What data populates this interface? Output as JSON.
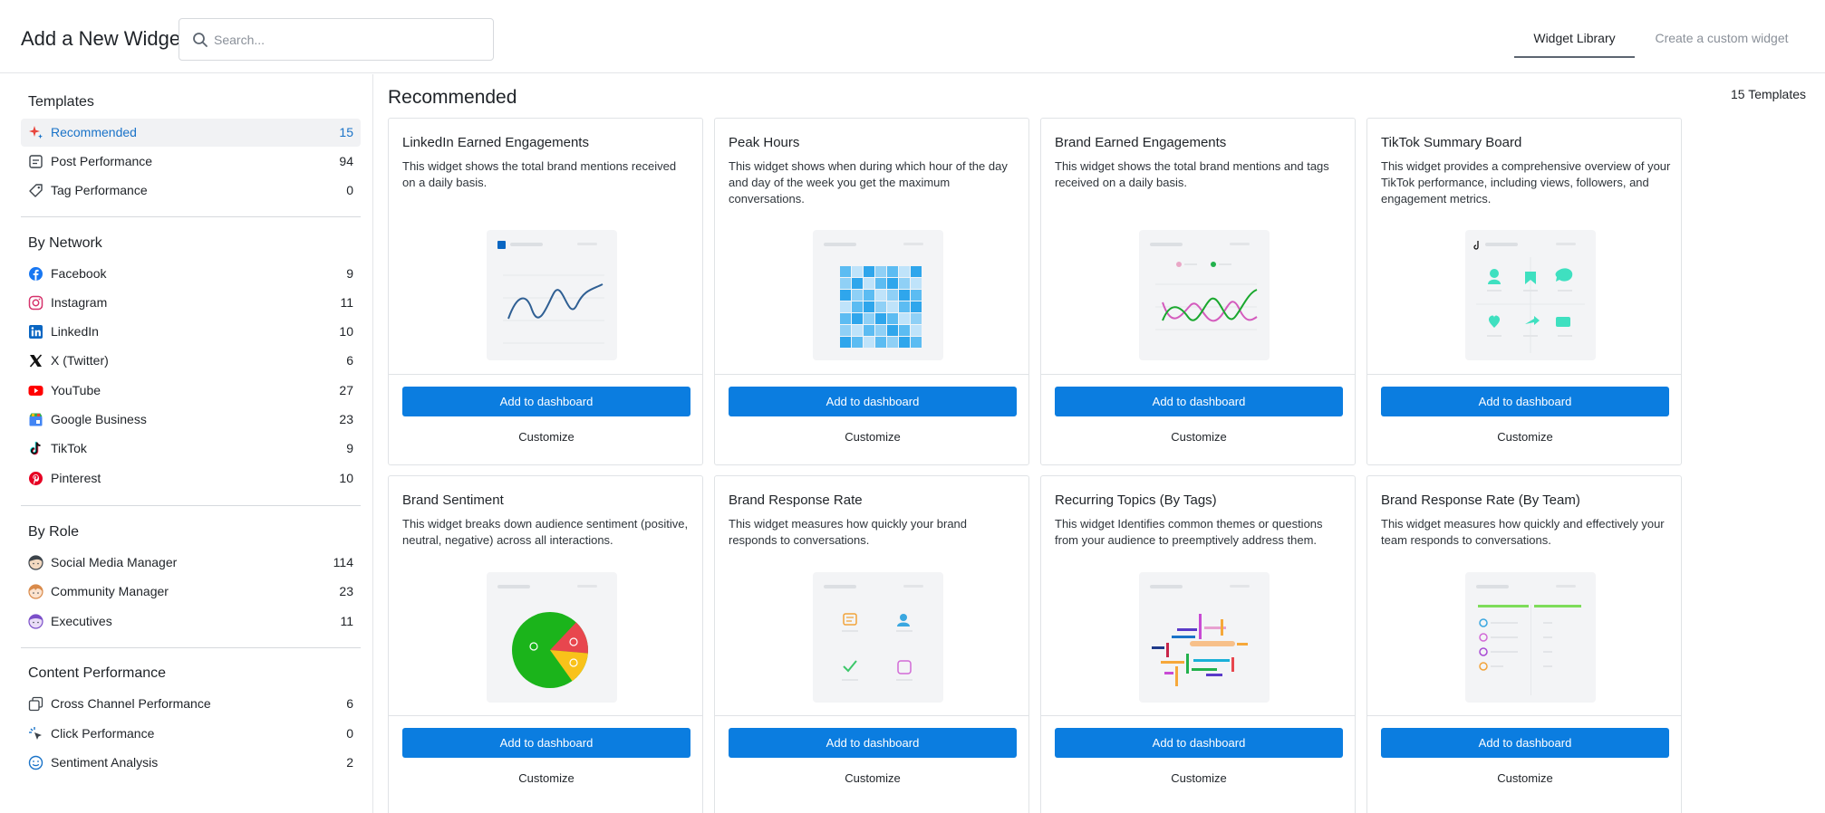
{
  "header": {
    "title": "Add a New Widget",
    "search_placeholder": "Search...",
    "tabs": [
      {
        "label": "Widget Library",
        "active": true
      },
      {
        "label": "Create a custom widget",
        "active": false
      }
    ]
  },
  "sidebar": {
    "sections": [
      {
        "title": "Templates",
        "items": [
          {
            "label": "Recommended",
            "count": "15",
            "icon": "sparkle-icon",
            "active": true
          },
          {
            "label": "Post Performance",
            "count": "94",
            "icon": "post-icon"
          },
          {
            "label": "Tag Performance",
            "count": "0",
            "icon": "tag-icon"
          }
        ]
      },
      {
        "title": "By Network",
        "items": [
          {
            "label": "Facebook",
            "count": "9",
            "icon": "facebook-icon"
          },
          {
            "label": "Instagram",
            "count": "11",
            "icon": "instagram-icon"
          },
          {
            "label": "LinkedIn",
            "count": "10",
            "icon": "linkedin-icon"
          },
          {
            "label": "X (Twitter)",
            "count": "6",
            "icon": "x-twitter-icon"
          },
          {
            "label": "YouTube",
            "count": "27",
            "icon": "youtube-icon"
          },
          {
            "label": "Google Business",
            "count": "23",
            "icon": "google-business-icon"
          },
          {
            "label": "TikTok",
            "count": "9",
            "icon": "tiktok-icon"
          },
          {
            "label": "Pinterest",
            "count": "10",
            "icon": "pinterest-icon"
          }
        ]
      },
      {
        "title": "By Role",
        "items": [
          {
            "label": "Social Media Manager",
            "count": "114",
            "icon": "social-manager-avatar-icon"
          },
          {
            "label": "Community Manager",
            "count": "23",
            "icon": "community-manager-avatar-icon"
          },
          {
            "label": "Executives",
            "count": "11",
            "icon": "executive-avatar-icon"
          }
        ]
      },
      {
        "title": "Content Performance",
        "items": [
          {
            "label": "Cross Channel Performance",
            "count": "6",
            "icon": "cross-channel-icon"
          },
          {
            "label": "Click Performance",
            "count": "0",
            "icon": "click-icon"
          },
          {
            "label": "Sentiment Analysis",
            "count": "2",
            "icon": "sentiment-icon"
          }
        ]
      }
    ]
  },
  "main": {
    "title": "Recommended",
    "template_count": "15 Templates",
    "add_label": "Add to dashboard",
    "customize_label": "Customize",
    "cards": [
      {
        "title": "LinkedIn Earned Engagements",
        "description": "This widget shows the total brand mentions received on a daily basis.",
        "preview": "line-chart-preview-icon"
      },
      {
        "title": "Peak Hours",
        "description": "This widget shows when during which hour of the day and day of the week you get the maximum conversations.",
        "preview": "heatmap-preview-icon"
      },
      {
        "title": "Brand Earned Engagements",
        "description": "This widget shows the total brand mentions and tags received on a daily basis.",
        "preview": "dual-line-preview-icon"
      },
      {
        "title": "TikTok Summary Board",
        "description": "This widget provides a comprehensive overview of your TikTok performance, including views, followers, and engagement metrics.",
        "preview": "summary-board-preview-icon"
      },
      {
        "title": "Brand Sentiment",
        "description": "This widget breaks down audience sentiment (positive, neutral, negative) across all interactions.",
        "preview": "pie-chart-preview-icon"
      },
      {
        "title": "Brand Response Rate",
        "description": "This widget measures how quickly your brand responds to conversations.",
        "preview": "response-rate-preview-icon"
      },
      {
        "title": "Recurring Topics (By Tags)",
        "description": "This widget Identifies common themes or questions from your audience to preemptively address them.",
        "preview": "topics-preview-icon"
      },
      {
        "title": "Brand Response Rate (By Team)",
        "description": "This widget measures how quickly and effectively your team responds to conversations.",
        "preview": "team-table-preview-icon"
      }
    ]
  },
  "colors": {
    "accent": "#0b7de0",
    "active_text": "#1a73c8",
    "border": "#e0e3e6"
  }
}
